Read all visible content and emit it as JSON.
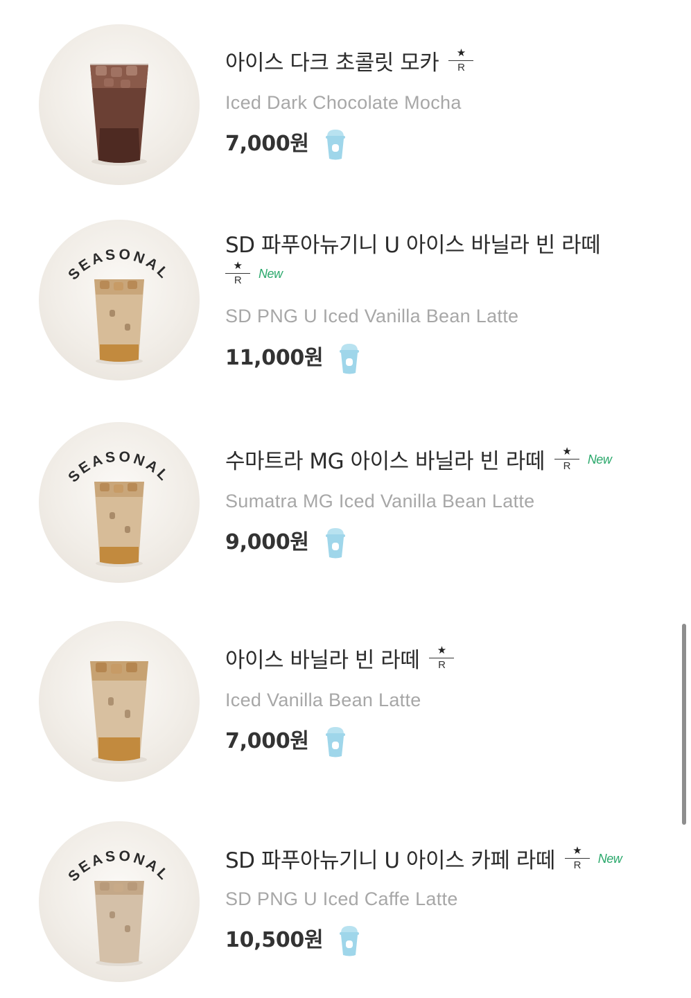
{
  "colors": {
    "new_badge": "#2aa86b",
    "price": "#333333",
    "english_name": "#a7a7a7",
    "cup_icon": "#9fd6ea"
  },
  "icons": {
    "reserve_star": "★",
    "reserve_letter": "R",
    "cup": "frappuccino-cup-icon"
  },
  "items": [
    {
      "name": "아이스 다크 초콜릿 모카",
      "english": "Iced Dark Chocolate Mocha",
      "price": "7,000원",
      "seasonal": false,
      "new": false,
      "drink": "mocha"
    },
    {
      "name_line1": "SD 파푸아뉴기니 U 아이스 바닐라 빈 라떼",
      "english": "SD PNG U Iced Vanilla Bean Latte",
      "price": "11,000원",
      "seasonal": true,
      "seasonal_label": "SEASONAL",
      "new": true,
      "new_label": "New",
      "drink": "latte"
    },
    {
      "name": "수마트라 MG 아이스 바닐라 빈 라떼",
      "english": "Sumatra MG Iced Vanilla Bean Latte",
      "price": "9,000원",
      "seasonal": true,
      "seasonal_label": "SEASONAL",
      "new": true,
      "new_label": "New",
      "drink": "latte"
    },
    {
      "name": "아이스 바닐라 빈 라떼",
      "english": "Iced Vanilla Bean Latte",
      "price": "7,000원",
      "seasonal": false,
      "new": false,
      "drink": "latte"
    },
    {
      "name": "SD 파푸아뉴기니 U 아이스 카페 라떼",
      "english": "SD PNG U Iced Caffe Latte",
      "price": "10,500원",
      "seasonal": true,
      "seasonal_label": "SEASONAL",
      "new": true,
      "new_label": "New",
      "drink": "latte"
    }
  ]
}
